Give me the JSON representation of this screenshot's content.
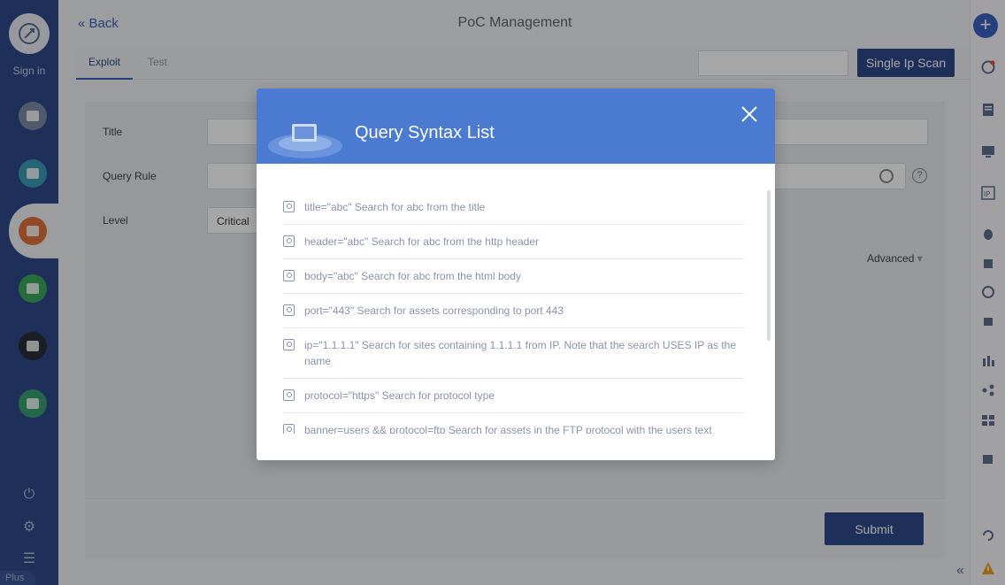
{
  "sidebar_left": {
    "signin_label": "Sign in",
    "plus_label": "Plus"
  },
  "page": {
    "back_label": "Back",
    "title": "PoC Management",
    "tabs": [
      {
        "label": "Exploit",
        "active": true
      },
      {
        "label": "Test",
        "active": false
      }
    ],
    "single_scan_label": "Single Ip Scan",
    "form": {
      "title_label": "Title",
      "query_rule_label": "Query Rule",
      "level_label": "Level",
      "level_value": "Critical",
      "advanced_label": "Advanced"
    },
    "submit_label": "Submit"
  },
  "modal": {
    "title": "Query Syntax List",
    "items": [
      "title=\"abc\" Search for abc from the title",
      "header=\"abc\" Search for abc from the http header",
      "body=\"abc\" Search for abc from the html body",
      "port=\"443\" Search for assets corresponding to port 443",
      "ip=\"1.1.1.1\" Search for sites containing 1.1.1.1 from IP. Note that the search USES IP as the name",
      "protocol=\"https\" Search for protocol type",
      "banner=users && protocol=ftp Search for assets in the FTP protocol with the users text"
    ]
  },
  "colors": {
    "sidebar": "#2e4b8a",
    "modal_header": "#4a7bd0",
    "primary_button": "#2e4b8a"
  }
}
